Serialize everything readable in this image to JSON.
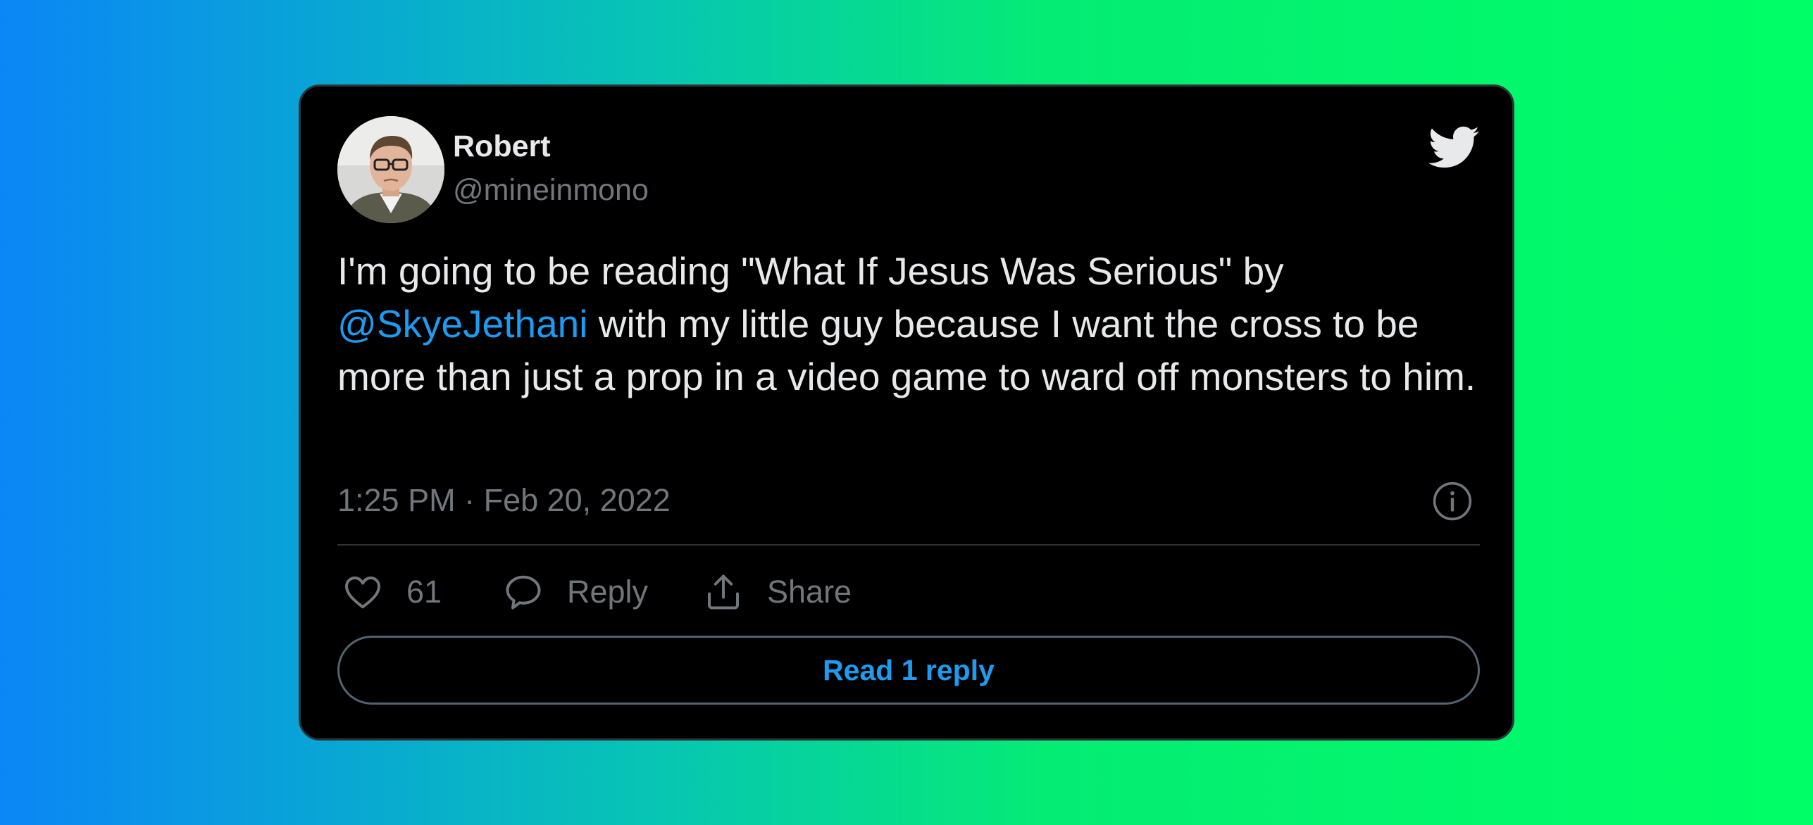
{
  "tweet": {
    "author": {
      "name": "Robert",
      "handle": "@mineinmono"
    },
    "text": {
      "before_mention": "I'm going to be reading \"What If Jesus Was Serious\" by ",
      "mention": "@SkyeJethani",
      "after_mention": " with my little guy because I want the cross to be more than just a prop in a video game to ward off monsters to him."
    },
    "timestamp": "1:25 PM · Feb 20, 2022",
    "actions": {
      "like_count": "61",
      "reply_label": "Reply",
      "share_label": "Share"
    },
    "read_replies_label": "Read 1 reply"
  },
  "icons": {
    "brand": "twitter-bird-icon",
    "info": "info-icon",
    "like": "heart-icon",
    "reply": "speech-bubble-icon",
    "share": "share-upload-icon"
  },
  "colors": {
    "card_background": "#000000",
    "text_primary": "#e7e9ea",
    "text_secondary": "#71767b",
    "accent": "#1d9bf0",
    "divider": "#2f3336",
    "gradient_start": "#0b86f6",
    "gradient_end": "#00ff66"
  }
}
